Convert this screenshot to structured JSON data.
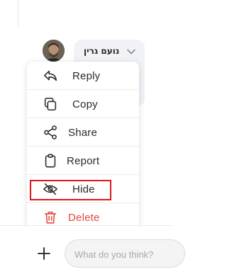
{
  "comment": {
    "author_name": "נועם גרין"
  },
  "menu": {
    "items": [
      {
        "label": "Reply",
        "icon": "reply-icon"
      },
      {
        "label": "Copy",
        "icon": "copy-icon"
      },
      {
        "label": "Share",
        "icon": "share-icon"
      },
      {
        "label": "Report",
        "icon": "clipboard-icon"
      },
      {
        "label": "Hide",
        "icon": "eye-off-icon"
      },
      {
        "label": "Delete",
        "icon": "trash-icon"
      }
    ]
  },
  "composer": {
    "placeholder": "What do you think?"
  },
  "colors": {
    "delete": "#e5493f",
    "highlight_border": "#e0141e",
    "text": "#2a2a2a"
  }
}
